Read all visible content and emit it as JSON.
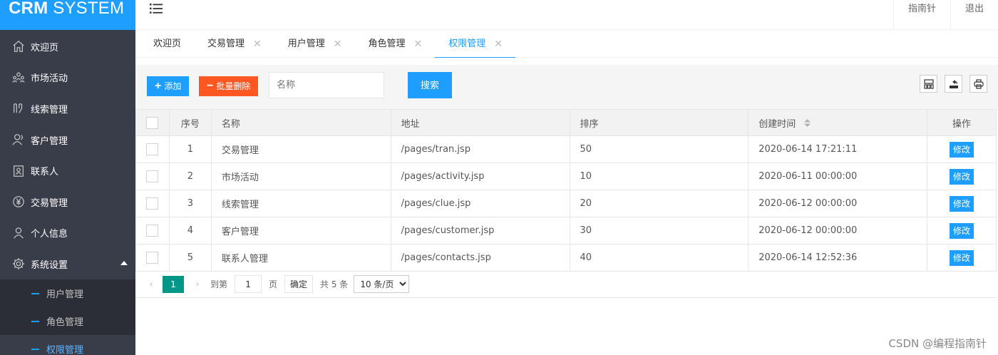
{
  "app": {
    "logo_bold": "CRM",
    "logo_rest": "SYSTEM"
  },
  "header": {
    "links": [
      "指南针",
      "退出"
    ]
  },
  "sidebar": {
    "items": [
      {
        "label": "欢迎页",
        "icon": "home-icon"
      },
      {
        "label": "市场活动",
        "icon": "users-group-icon"
      },
      {
        "label": "线索管理",
        "icon": "clue-icon"
      },
      {
        "label": "客户管理",
        "icon": "user-icon"
      },
      {
        "label": "联系人",
        "icon": "contact-card-icon"
      },
      {
        "label": "交易管理",
        "icon": "yen-circle-icon"
      },
      {
        "label": "个人信息",
        "icon": "user-icon"
      },
      {
        "label": "系统设置",
        "icon": "gear-icon"
      }
    ],
    "sub_items": [
      "用户管理",
      "角色管理",
      "权限管理"
    ]
  },
  "tabs": [
    "欢迎页",
    "交易管理",
    "用户管理",
    "角色管理",
    "权限管理"
  ],
  "toolbar": {
    "add_label": "添加",
    "batch_delete_label": "批量删除",
    "search_placeholder": "名称",
    "search_label": "搜索"
  },
  "table": {
    "headers": [
      "序号",
      "名称",
      "地址",
      "排序",
      "创建时间",
      "操作"
    ],
    "rows": [
      {
        "no": "1",
        "name": "交易管理",
        "url": "/pages/tran.jsp",
        "order": "50",
        "created": "2020-06-14 17:21:11",
        "action": "修改"
      },
      {
        "no": "2",
        "name": "市场活动",
        "url": "/pages/activity.jsp",
        "order": "10",
        "created": "2020-06-11 00:00:00",
        "action": "修改"
      },
      {
        "no": "3",
        "name": "线索管理",
        "url": "/pages/clue.jsp",
        "order": "20",
        "created": "2020-06-12 00:00:00",
        "action": "修改"
      },
      {
        "no": "4",
        "name": "客户管理",
        "url": "/pages/customer.jsp",
        "order": "30",
        "created": "2020-06-12 00:00:00",
        "action": "修改"
      },
      {
        "no": "5",
        "name": "联系人管理",
        "url": "/pages/contacts.jsp",
        "order": "40",
        "created": "2020-06-14 12:52:36",
        "action": "修改"
      }
    ]
  },
  "pager": {
    "current": "1",
    "goto_label": "到第",
    "page_value": "1",
    "page_unit": "页",
    "confirm_label": "确定",
    "total": "共 5 条",
    "page_size": "10 条/页"
  },
  "watermark": "CSDN @编程指南针",
  "colors": {
    "accent": "#1e9fff",
    "danger": "#ff5722",
    "sidebar_bg": "#393d49",
    "pager_active": "#009688"
  }
}
